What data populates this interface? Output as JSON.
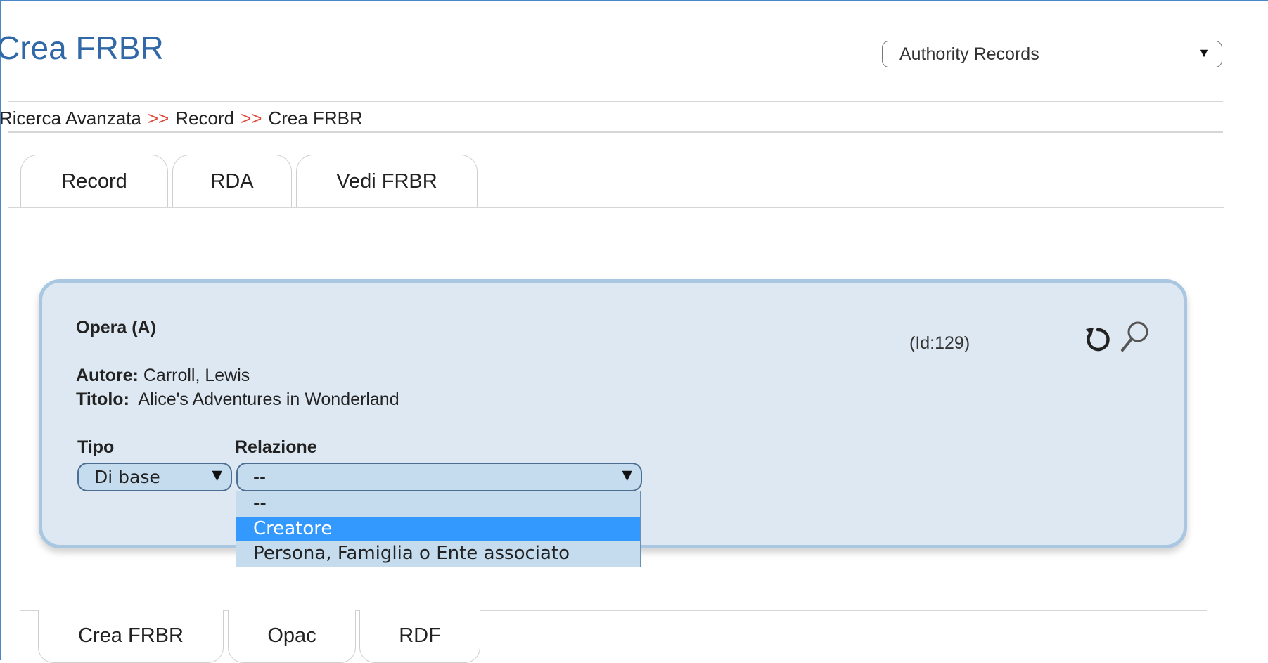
{
  "header": {
    "title": "Crea FRBR",
    "record_type_select": "Authority Records"
  },
  "breadcrumb": {
    "items": [
      "Ricerca Avanzata",
      "Record",
      "Crea FRBR"
    ],
    "separator": ">>"
  },
  "tabs_top": [
    {
      "label": "Record",
      "active": true
    },
    {
      "label": "RDA",
      "active": false
    },
    {
      "label": "Vedi FRBR",
      "active": false
    }
  ],
  "card": {
    "heading": "Opera (A)",
    "id_text": "(Id:129)",
    "autore_label": "Autore:",
    "autore_value": "Carroll, Lewis",
    "titolo_label": "Titolo:",
    "titolo_value": "Alice's Adventures in Wonderland",
    "tipo_label": "Tipo",
    "tipo_value": "Di base",
    "relazione_label": "Relazione",
    "relazione_value": "--",
    "refresh_icon": "refresh-icon",
    "search_icon": "search-icon"
  },
  "relazione_dropdown": {
    "options": [
      "--",
      "Creatore",
      "Persona, Famiglia o Ente associato"
    ],
    "highlighted": "Creatore"
  },
  "tabs_bottom": [
    {
      "label": "Crea FRBR"
    },
    {
      "label": "Opac"
    },
    {
      "label": "RDF"
    }
  ],
  "colors": {
    "title": "#3168a8",
    "separator": "#e04a3a",
    "card_bg": "#dde8f2",
    "card_border": "#a9c7e0",
    "select_bg": "#c5dcee",
    "highlight": "#3399ff"
  }
}
